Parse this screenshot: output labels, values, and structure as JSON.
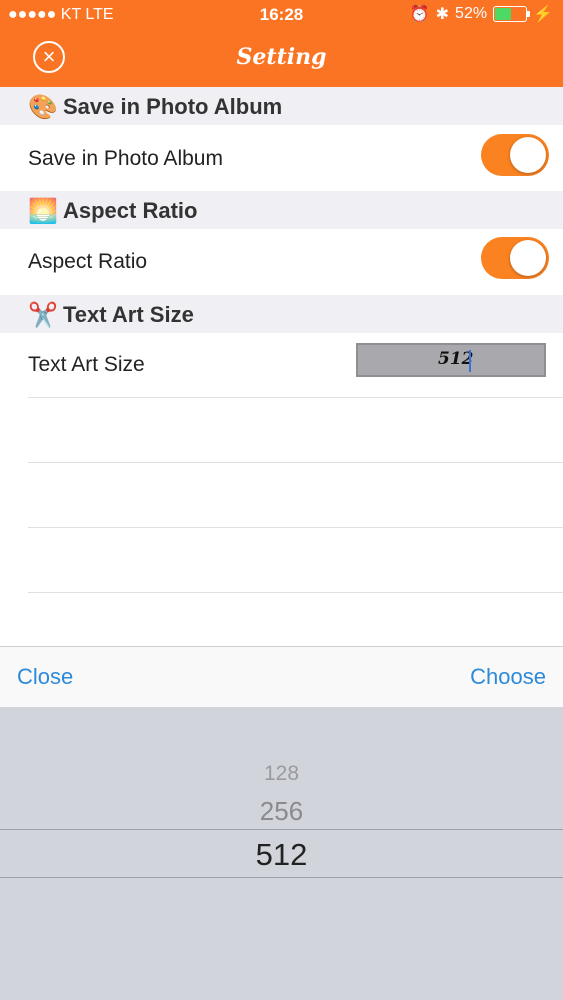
{
  "status_bar": {
    "carrier": "●●●●● KT  LTE",
    "time": "16:28",
    "battery_pct": "52%",
    "battery_level": 0.52,
    "icons": [
      "alarm-icon",
      "bluetooth-icon",
      "battery-icon",
      "charging-icon"
    ]
  },
  "header": {
    "title": "Setting",
    "accent_color": "#fa7423"
  },
  "sections": {
    "save": {
      "header": "Save in Photo Album",
      "emoji": "🎨",
      "row_label": "Save in Photo Album",
      "toggle_on": true
    },
    "aspect": {
      "header": "Aspect Ratio",
      "emoji": "🌅",
      "row_label": "Aspect Ratio",
      "toggle_on": true
    },
    "size": {
      "header": "Text Art Size",
      "emoji": "✂️",
      "row_label": "Text Art Size",
      "value": "512"
    }
  },
  "toolbar": {
    "close_label": "Close",
    "choose_label": "Choose"
  },
  "picker": {
    "options": [
      "128",
      "256",
      "512"
    ],
    "selected": "512"
  }
}
